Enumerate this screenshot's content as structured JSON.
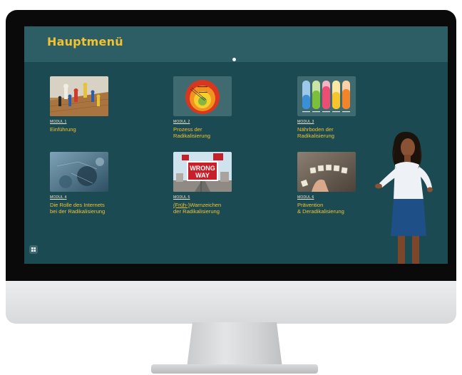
{
  "header": {
    "title": "Hauptmenü"
  },
  "modules": [
    {
      "tag": "MODUL 1",
      "title_line1": "Einführung",
      "title_line2": "",
      "thumb": "chess-pieces-photo"
    },
    {
      "tag": "MODUL 2",
      "title_line1": "Prozess der",
      "title_line2": "Radikalisierung",
      "thumb": "concentric-circles-diagram"
    },
    {
      "tag": "MODUL 3",
      "title_line1": "Nährboden der",
      "title_line2": "Radikalisierung",
      "thumb": "bar-columns-graphic"
    },
    {
      "tag": "MODUL 4",
      "title_line1": "Die Rolle des Internets",
      "title_line2": "bei der Radikalisierung",
      "thumb": "blurred-network-photo"
    },
    {
      "tag": "MODUL 5",
      "title_prefix": "(Früh-)",
      "title_line1": "Warnzeichen",
      "title_line2": "der Radikalisierung",
      "thumb": "wrong-way-sign-photo"
    },
    {
      "tag": "MODUL 6",
      "title_line1": "Prävention",
      "title_line2": "& Deradikalisierung",
      "thumb": "letter-tiles-photo"
    }
  ],
  "wrong_way_sign": {
    "line1": "WRONG",
    "line2": "WAY"
  },
  "icons": {
    "menu": "grid-menu-icon"
  },
  "colors": {
    "screen_bg": "#1b4a53",
    "header_bg": "#2d5d65",
    "title": "#f2c230",
    "module_title": "#f2c230",
    "module_tag": "#f4ead0"
  }
}
